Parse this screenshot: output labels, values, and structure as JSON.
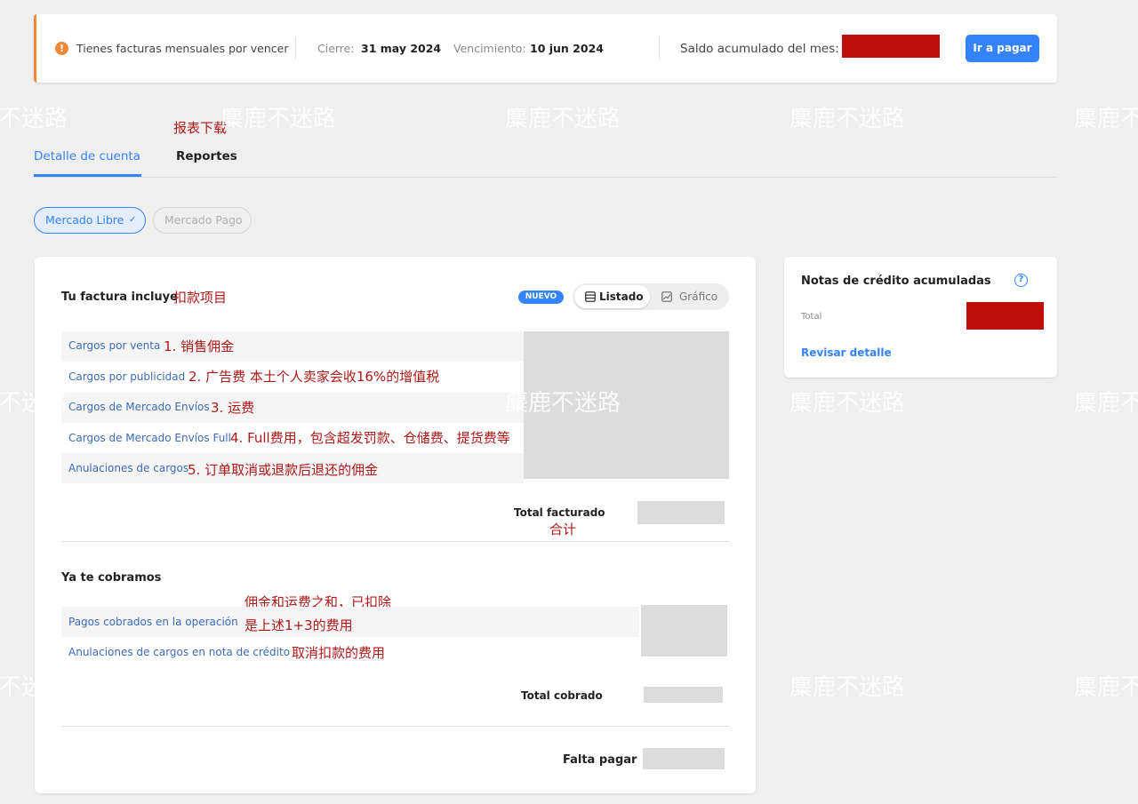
{
  "banner": {
    "message": "Tienes facturas mensuales por vencer",
    "cierre_label": "Cierre:",
    "cierre_value": "31 may 2024",
    "vencimiento_label": "Vencimiento:",
    "vencimiento_value": "10 jun 2024",
    "saldo_label": "Saldo acumulado del mes:",
    "pay_button": "Ir a pagar",
    "warning_color": "#f0883a",
    "accent_color": "#3483fa"
  },
  "annotations": {
    "tabs_note": "报表下载",
    "section_note": "扣款项目",
    "row_notes": [
      "1. 销售佣金",
      "2. 广告费 本土个人卖家会收16%的增值税",
      "3. 运费",
      "4. Full费用，包含超发罚款、仓储费、提货费等",
      "5. 订单取消或退款后退还的佣金"
    ],
    "total_note": "合计",
    "collected_note_1": "佣金和运费之和，已扣除",
    "collected_note_2": "是上述1+3的费用",
    "cancel_note": "取消扣款的费用",
    "watermark": "麋鹿不迷路",
    "watermark_cut_a": "不迷路",
    "watermark_cut_b": "不迷",
    "watermark_cut_c": "麋鹿不",
    "note_color": "#b01818"
  },
  "tabs": [
    {
      "label": "Detalle de cuenta",
      "active": true
    },
    {
      "label": "Reportes",
      "active": false
    }
  ],
  "filters": {
    "active": "Mercado Libre",
    "inactive": "Mercado Pago"
  },
  "invoice": {
    "title": "Tu factura incluye",
    "badge": "NUEVO",
    "view_list": "Listado",
    "view_chart": "Gráfico",
    "rows": [
      "Cargos por venta",
      "Cargos por publicidad",
      "Cargos de Mercado Envíos",
      "Cargos de Mercado Envíos Full",
      "Anulaciones de cargos"
    ],
    "total_label": "Total facturado"
  },
  "collected": {
    "title": "Ya te cobramos",
    "rows": [
      "Pagos cobrados en la operación",
      "Anulaciones de cargos en nota de crédito"
    ],
    "total_label": "Total cobrado"
  },
  "due": {
    "label": "Falta pagar"
  },
  "credit_notes": {
    "title": "Notas de crédito acumuladas",
    "help": "?",
    "total_label": "Total",
    "link": "Revisar detalle"
  },
  "icons": {
    "warning": "warning-icon",
    "chevron": "chevron-down-icon",
    "list": "list-icon",
    "chart": "chart-icon",
    "help": "help-circle-icon"
  }
}
